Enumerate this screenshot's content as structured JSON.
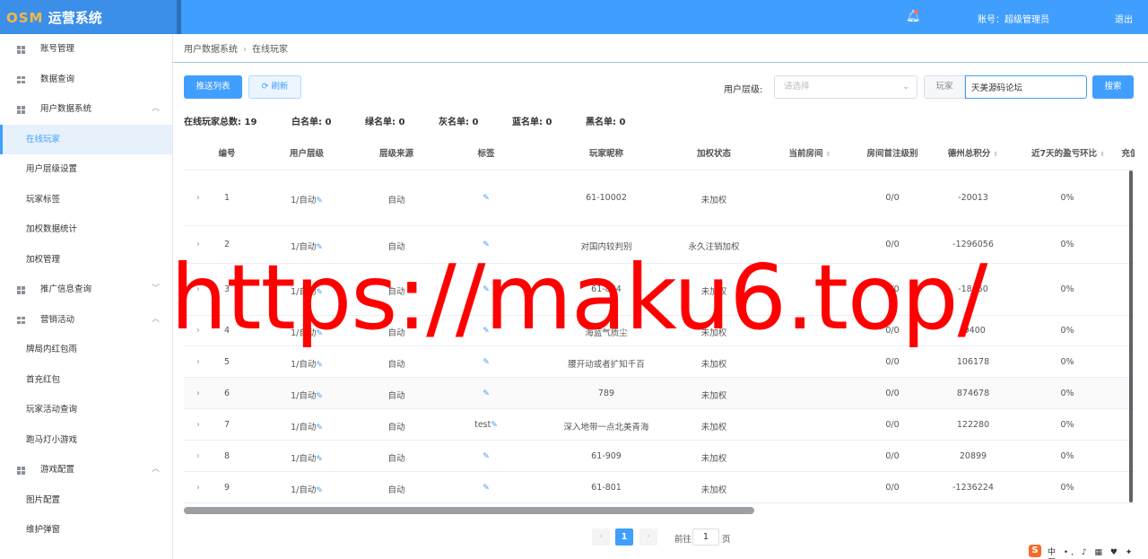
{
  "header": {
    "logo_brand": "OSM",
    "logo_text": "运营系统",
    "account": "账号：超级管理员",
    "logout": "退出"
  },
  "sidebar": {
    "items": [
      {
        "label": "账号管理",
        "type": "parent",
        "arrow": ""
      },
      {
        "label": "数据查询",
        "type": "parent",
        "arrow": ""
      },
      {
        "label": "用户数据系统",
        "type": "parent",
        "arrow": "︿"
      },
      {
        "label": "在线玩家",
        "type": "child",
        "active": true
      },
      {
        "label": "用户层级设置",
        "type": "child"
      },
      {
        "label": "玩家标签",
        "type": "child"
      },
      {
        "label": "加权数据统计",
        "type": "child"
      },
      {
        "label": "加权管理",
        "type": "child"
      },
      {
        "label": "推广信息查询",
        "type": "parent",
        "arrow": "﹀"
      },
      {
        "label": "营销活动",
        "type": "parent",
        "arrow": "︿"
      },
      {
        "label": "牌局内红包雨",
        "type": "child"
      },
      {
        "label": "首充红包",
        "type": "child"
      },
      {
        "label": "玩家活动查询",
        "type": "child"
      },
      {
        "label": "跑马灯小游戏",
        "type": "child"
      },
      {
        "label": "游戏配置",
        "type": "parent",
        "arrow": "︿"
      },
      {
        "label": "图片配置",
        "type": "child"
      },
      {
        "label": "维护弹窗",
        "type": "child"
      }
    ]
  },
  "breadcrumb": {
    "parent": "用户数据系统",
    "sep": "›",
    "current": "在线玩家"
  },
  "toolbar": {
    "push_list": "推送列表",
    "refresh": "刷新",
    "level_label": "用户层级:",
    "level_placeholder": "请选择",
    "player_prefix": "玩家",
    "player_value": "天美源码论坛",
    "search": "搜索"
  },
  "stats": {
    "total": "在线玩家总数: 19",
    "white": "白名单: 0",
    "green": "绿名单: 0",
    "gray": "灰名单: 0",
    "blue": "蓝名单: 0",
    "black": "黑名单: 0"
  },
  "table": {
    "columns": [
      "编号",
      "用户层级",
      "层级来源",
      "标签",
      "玩家昵称",
      "加权状态",
      "当前房间",
      "房间首注级别",
      "德州总积分",
      "近7天的盈亏环比",
      "充值"
    ],
    "rows": [
      {
        "id": "1",
        "level": "1/自动",
        "source": "自动",
        "tag": "",
        "nickname": "61-10002",
        "weight": "未加权",
        "room": "",
        "first_bet": "0/0",
        "score": "-20013",
        "ratio": "0%"
      },
      {
        "id": "2",
        "level": "1/自动",
        "source": "自动",
        "tag": "",
        "nickname": "对国内较判别",
        "weight": "永久注销加权",
        "room": "",
        "first_bet": "0/0",
        "score": "-1296056",
        "ratio": "0%"
      },
      {
        "id": "3",
        "level": "1/自动",
        "source": "自动",
        "tag": "",
        "nickname": "61-804",
        "weight": "未加权",
        "room": "",
        "first_bet": "0/0",
        "score": "-18650",
        "ratio": "0%"
      },
      {
        "id": "4",
        "level": "1/自动",
        "source": "自动",
        "tag": "",
        "nickname": "海蓝气质尘",
        "weight": "未加权",
        "room": "",
        "first_bet": "0/0",
        "score": "-9400",
        "ratio": "0%"
      },
      {
        "id": "5",
        "level": "1/自动",
        "source": "自动",
        "tag": "",
        "nickname": "腰开动或者扩知千百",
        "weight": "未加权",
        "room": "",
        "first_bet": "0/0",
        "score": "106178",
        "ratio": "0%"
      },
      {
        "id": "6",
        "level": "1/自动",
        "source": "自动",
        "tag": "",
        "nickname": "789",
        "weight": "未加权",
        "room": "",
        "first_bet": "0/0",
        "score": "874678",
        "ratio": "0%"
      },
      {
        "id": "7",
        "level": "1/自动",
        "source": "自动",
        "tag": "test",
        "nickname": "深入地带一点北美青海",
        "weight": "未加权",
        "room": "",
        "first_bet": "0/0",
        "score": "122280",
        "ratio": "0%"
      },
      {
        "id": "8",
        "level": "1/自动",
        "source": "自动",
        "tag": "",
        "nickname": "61-909",
        "weight": "未加权",
        "room": "",
        "first_bet": "0/0",
        "score": "20899",
        "ratio": "0%"
      },
      {
        "id": "9",
        "level": "1/自动",
        "source": "自动",
        "tag": "",
        "nickname": "61-801",
        "weight": "未加权",
        "room": "",
        "first_bet": "0/0",
        "score": "-1236224",
        "ratio": "0%"
      }
    ]
  },
  "pagination": {
    "prev": "‹",
    "current": "1",
    "next": "›",
    "goto": "前往",
    "goto_value": "1",
    "page_unit": "页"
  },
  "watermark": "https://maku6.top/",
  "ime": {
    "logo": "S",
    "text": "中 •, ♪ ▦ ♥ ✦ ▦"
  },
  "colors": {
    "primary": "#409eff",
    "watermark": "#ff0000"
  }
}
